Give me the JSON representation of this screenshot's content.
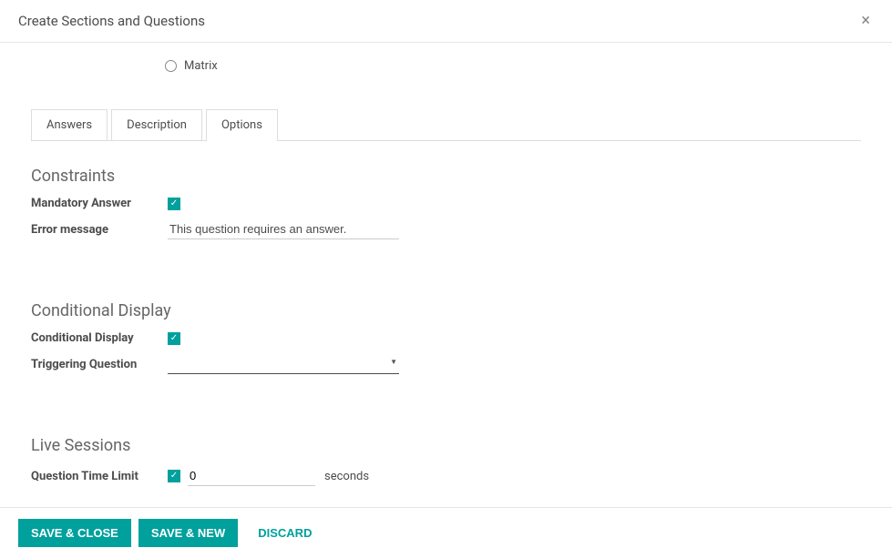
{
  "modal": {
    "title": "Create Sections and Questions"
  },
  "radio": {
    "matrix_label": "Matrix"
  },
  "tabs": {
    "answers": "Answers",
    "description": "Description",
    "options": "Options"
  },
  "sections": {
    "constraints": {
      "heading": "Constraints",
      "mandatory_label": "Mandatory Answer",
      "error_label": "Error message",
      "error_value": "This question requires an answer."
    },
    "conditional": {
      "heading": "Conditional Display",
      "display_label": "Conditional Display",
      "trigger_label": "Triggering Question",
      "trigger_value": ""
    },
    "live": {
      "heading": "Live Sessions",
      "limit_label": "Question Time Limit",
      "limit_value": "0",
      "unit": "seconds"
    }
  },
  "footer": {
    "save_close": "SAVE & CLOSE",
    "save_new": "SAVE & NEW",
    "discard": "DISCARD"
  }
}
